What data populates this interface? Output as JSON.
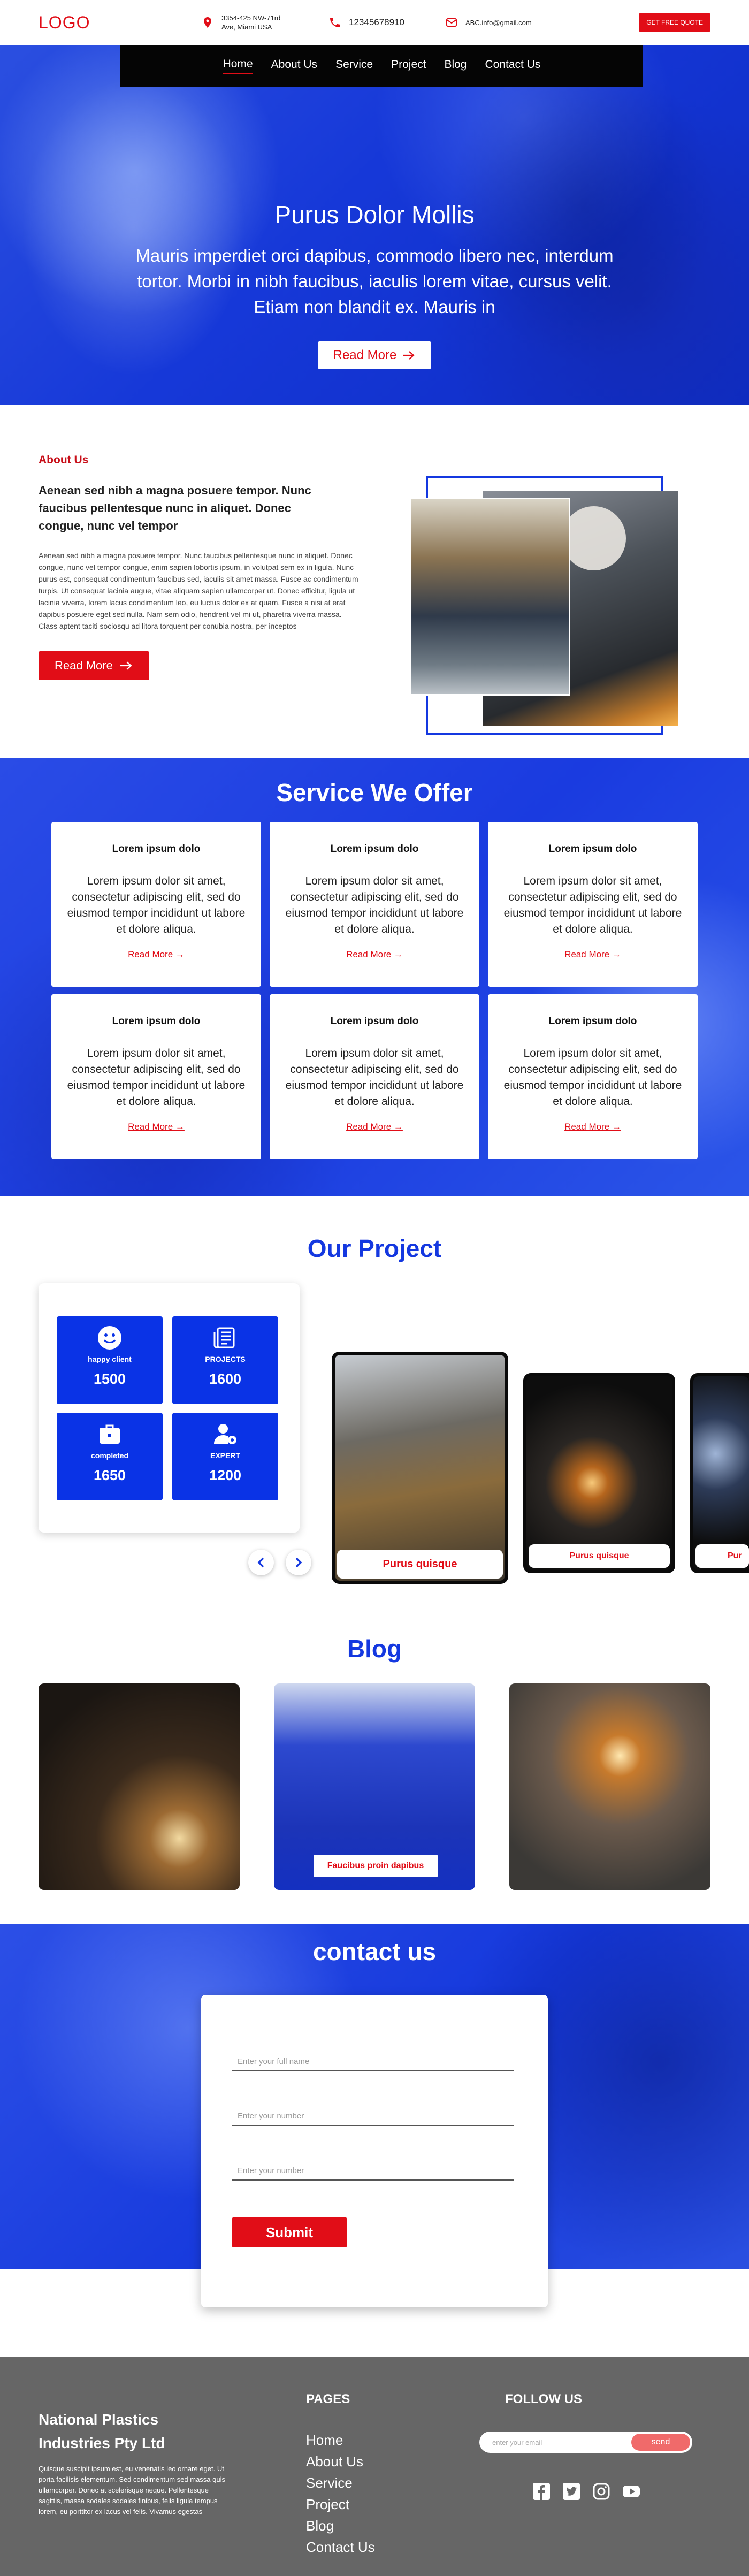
{
  "header": {
    "logo": "LOGO",
    "address_line1": "3354-425 NW-71rd",
    "address_line2": "Ave, Miami USA",
    "phone": "12345678910",
    "email": "ABC.info@gmail.com",
    "quote_button": "GET FREE QUOTE"
  },
  "nav": {
    "items": [
      "Home",
      "About Us",
      "Service",
      "Project",
      "Blog",
      "Contact Us"
    ],
    "active": "Home"
  },
  "hero": {
    "title": "Purus Dolor Mollis",
    "text": "Mauris imperdiet orci dapibus, commodo libero nec, interdum tortor. Morbi in nibh faucibus, iaculis lorem vitae, cursus velit. Etiam non blandit ex. Mauris in",
    "button": "Read More"
  },
  "about": {
    "eyebrow": "About Us",
    "lead": "Aenean sed nibh a magna posuere tempor. Nunc faucibus pellentesque nunc in aliquet. Donec congue, nunc vel tempor",
    "body": "Aenean sed nibh a magna posuere tempor. Nunc faucibus pellentesque nunc in aliquet. Donec congue, nunc vel tempor congue, enim sapien lobortis ipsum, in volutpat sem ex in ligula. Nunc purus est, consequat condimentum faucibus sed, iaculis sit amet massa. Fusce ac condimentum turpis. Ut consequat lacinia augue, vitae aliquam sapien ullamcorper ut. Donec efficitur, ligula ut lacinia viverra, lorem lacus condimentum leo, eu luctus dolor ex at quam. Fusce a nisi at erat dapibus posuere eget sed nulla. Nam sem odio, hendrerit vel mi ut, pharetra viverra massa. Class aptent taciti sociosqu ad litora torquent per conubia nostra, per inceptos",
    "button": "Read More"
  },
  "services": {
    "title": "Service We Offer",
    "cards": [
      {
        "title": "Lorem ipsum dolo",
        "text": "Lorem ipsum dolor sit amet, consectetur adipiscing elit, sed do eiusmod tempor incididunt ut labore et dolore aliqua.",
        "link": "Read More →"
      },
      {
        "title": "Lorem ipsum dolo",
        "text": "Lorem ipsum dolor sit amet, consectetur adipiscing elit, sed do eiusmod tempor incididunt ut labore et dolore aliqua.",
        "link": "Read More →"
      },
      {
        "title": "Lorem ipsum dolo",
        "text": "Lorem ipsum dolor sit amet, consectetur adipiscing elit, sed do eiusmod tempor incididunt ut labore et dolore aliqua.",
        "link": "Read More →"
      },
      {
        "title": "Lorem ipsum dolo",
        "text": "Lorem ipsum dolor sit amet, consectetur adipiscing elit, sed do eiusmod tempor incididunt ut labore et dolore aliqua.",
        "link": "Read More →"
      },
      {
        "title": "Lorem ipsum dolo",
        "text": "Lorem ipsum dolor sit amet, consectetur adipiscing elit, sed do eiusmod tempor incididunt ut labore et dolore aliqua.",
        "link": "Read More →"
      },
      {
        "title": "Lorem ipsum dolo",
        "text": "Lorem ipsum dolor sit amet, consectetur adipiscing elit, sed do eiusmod tempor incididunt ut labore et dolore aliqua.",
        "link": "Read More →"
      }
    ]
  },
  "project": {
    "title": "Our Project",
    "stats": [
      {
        "label": "happy client",
        "value": "1500",
        "icon": "smiley-icon"
      },
      {
        "label": "PROJECTS",
        "value": "1600",
        "icon": "newspaper-icon"
      },
      {
        "label": "completed",
        "value": "1650",
        "icon": "briefcase-icon"
      },
      {
        "label": "EXPERT",
        "value": "1200",
        "icon": "user-gear-icon"
      }
    ],
    "cards": [
      "Purus quisque",
      "Purus quisque",
      "Pur"
    ]
  },
  "blog": {
    "title": "Blog",
    "caption": "Faucibus proin dapibus"
  },
  "contact": {
    "title": "contact us",
    "name_placeholder": "Enter your full name",
    "number_placeholder": "Enter your number",
    "number2_placeholder": "Enter your number",
    "submit": "Submit"
  },
  "footer": {
    "brand": "National Plastics Industries Pty Ltd",
    "about": "Quisque suscipit ipsum est, eu venenatis leo ornare eget. Ut porta facilisis elementum. Sed condimentum sed massa quis ullamcorper. Donec at scelerisque neque. Pellentesque sagittis, massa sodales sodales finibus, felis ligula tempus lorem, eu porttitor ex lacus vel felis. Vivamus egestas",
    "pages_heading": "PAGES",
    "links": [
      "Home",
      "About Us",
      "Service",
      "Project",
      "Blog",
      "Contact Us"
    ],
    "follow_heading": "FOLLOW US",
    "email_placeholder": "enter your email",
    "send": "send",
    "socials": [
      "facebook-icon",
      "twitter-icon",
      "instagram-icon",
      "youtube-icon"
    ]
  },
  "colors": {
    "brand_red": "#e10d17",
    "brand_blue": "#1438e0",
    "footer_gray": "#666666"
  }
}
